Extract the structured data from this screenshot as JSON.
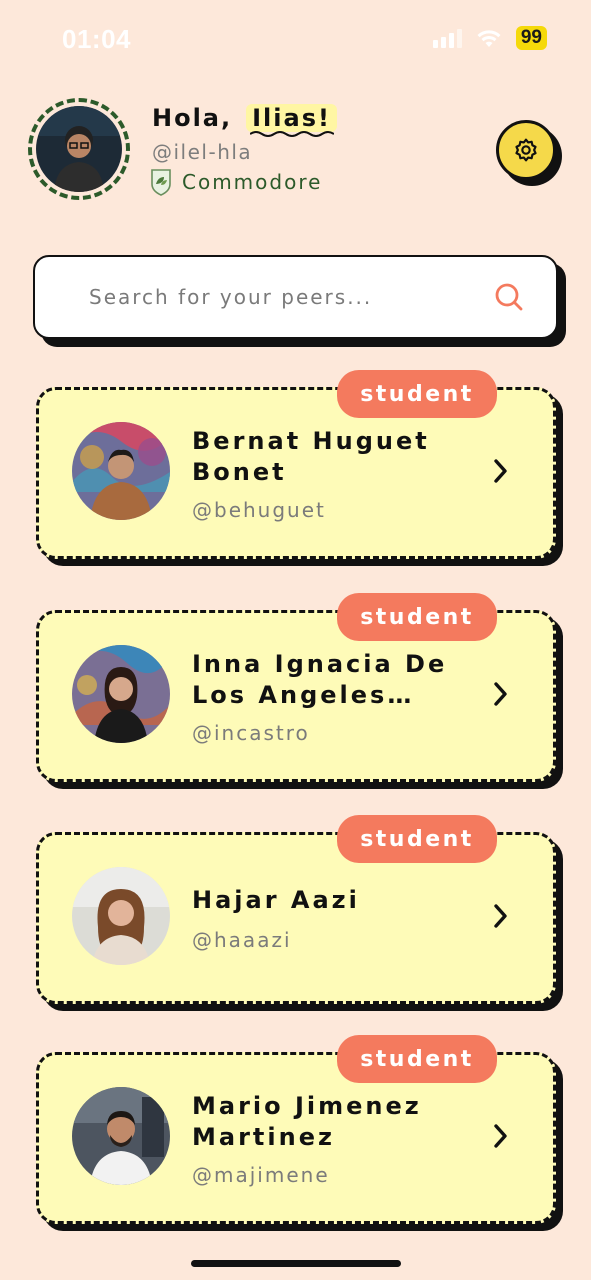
{
  "status_bar": {
    "time": "01:04",
    "battery": "99"
  },
  "header": {
    "greeting": "Hola,",
    "name": "Ilias!",
    "handle": "@ilel-hla",
    "rank": "Commodore"
  },
  "search": {
    "placeholder": "Search for your peers..."
  },
  "peers": [
    {
      "role": "student",
      "name": "Bernat Huguet Bonet",
      "handle": "@behuguet"
    },
    {
      "role": "student",
      "name": "Inna Ignacia De Los Angeles…",
      "handle": "@incastro"
    },
    {
      "role": "student",
      "name": "Hajar Aazi",
      "handle": "@haaazi"
    },
    {
      "role": "student",
      "name": "Mario Jimenez Martinez",
      "handle": "@majimene"
    }
  ],
  "colors": {
    "background": "#fde8da",
    "card": "#fefbb8",
    "badge": "#f47a5e",
    "accent_green": "#2c5a2a",
    "settings_button": "#f5d94a"
  },
  "icons": [
    "signal-icon",
    "wifi-icon",
    "rank-icon",
    "gear-icon",
    "search-icon",
    "chevron-right-icon"
  ]
}
